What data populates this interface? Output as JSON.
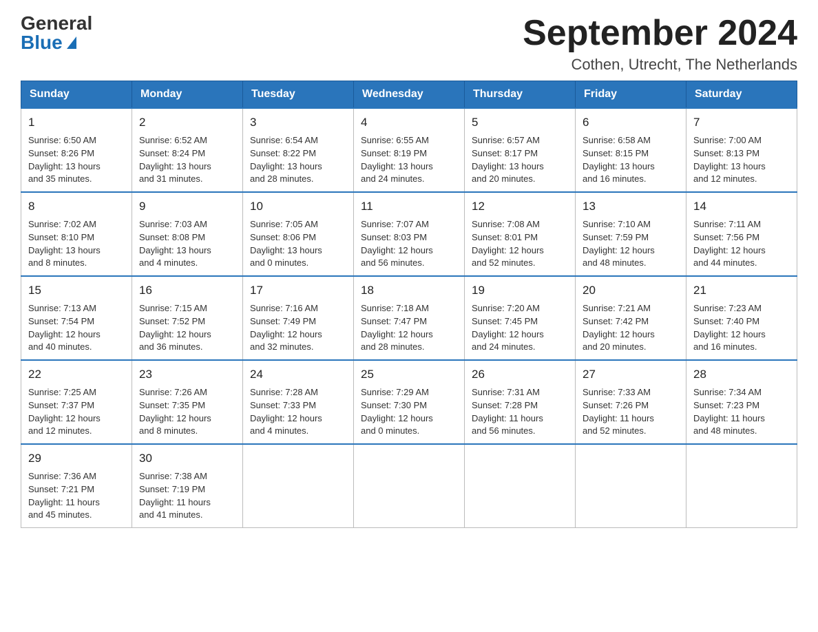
{
  "logo": {
    "general": "General",
    "blue": "Blue"
  },
  "title": {
    "month_year": "September 2024",
    "location": "Cothen, Utrecht, The Netherlands"
  },
  "weekdays": [
    "Sunday",
    "Monday",
    "Tuesday",
    "Wednesday",
    "Thursday",
    "Friday",
    "Saturday"
  ],
  "weeks": [
    [
      {
        "day": "1",
        "sunrise": "6:50 AM",
        "sunset": "8:26 PM",
        "daylight": "13 hours and 35 minutes."
      },
      {
        "day": "2",
        "sunrise": "6:52 AM",
        "sunset": "8:24 PM",
        "daylight": "13 hours and 31 minutes."
      },
      {
        "day": "3",
        "sunrise": "6:54 AM",
        "sunset": "8:22 PM",
        "daylight": "13 hours and 28 minutes."
      },
      {
        "day": "4",
        "sunrise": "6:55 AM",
        "sunset": "8:19 PM",
        "daylight": "13 hours and 24 minutes."
      },
      {
        "day": "5",
        "sunrise": "6:57 AM",
        "sunset": "8:17 PM",
        "daylight": "13 hours and 20 minutes."
      },
      {
        "day": "6",
        "sunrise": "6:58 AM",
        "sunset": "8:15 PM",
        "daylight": "13 hours and 16 minutes."
      },
      {
        "day": "7",
        "sunrise": "7:00 AM",
        "sunset": "8:13 PM",
        "daylight": "13 hours and 12 minutes."
      }
    ],
    [
      {
        "day": "8",
        "sunrise": "7:02 AM",
        "sunset": "8:10 PM",
        "daylight": "13 hours and 8 minutes."
      },
      {
        "day": "9",
        "sunrise": "7:03 AM",
        "sunset": "8:08 PM",
        "daylight": "13 hours and 4 minutes."
      },
      {
        "day": "10",
        "sunrise": "7:05 AM",
        "sunset": "8:06 PM",
        "daylight": "13 hours and 0 minutes."
      },
      {
        "day": "11",
        "sunrise": "7:07 AM",
        "sunset": "8:03 PM",
        "daylight": "12 hours and 56 minutes."
      },
      {
        "day": "12",
        "sunrise": "7:08 AM",
        "sunset": "8:01 PM",
        "daylight": "12 hours and 52 minutes."
      },
      {
        "day": "13",
        "sunrise": "7:10 AM",
        "sunset": "7:59 PM",
        "daylight": "12 hours and 48 minutes."
      },
      {
        "day": "14",
        "sunrise": "7:11 AM",
        "sunset": "7:56 PM",
        "daylight": "12 hours and 44 minutes."
      }
    ],
    [
      {
        "day": "15",
        "sunrise": "7:13 AM",
        "sunset": "7:54 PM",
        "daylight": "12 hours and 40 minutes."
      },
      {
        "day": "16",
        "sunrise": "7:15 AM",
        "sunset": "7:52 PM",
        "daylight": "12 hours and 36 minutes."
      },
      {
        "day": "17",
        "sunrise": "7:16 AM",
        "sunset": "7:49 PM",
        "daylight": "12 hours and 32 minutes."
      },
      {
        "day": "18",
        "sunrise": "7:18 AM",
        "sunset": "7:47 PM",
        "daylight": "12 hours and 28 minutes."
      },
      {
        "day": "19",
        "sunrise": "7:20 AM",
        "sunset": "7:45 PM",
        "daylight": "12 hours and 24 minutes."
      },
      {
        "day": "20",
        "sunrise": "7:21 AM",
        "sunset": "7:42 PM",
        "daylight": "12 hours and 20 minutes."
      },
      {
        "day": "21",
        "sunrise": "7:23 AM",
        "sunset": "7:40 PM",
        "daylight": "12 hours and 16 minutes."
      }
    ],
    [
      {
        "day": "22",
        "sunrise": "7:25 AM",
        "sunset": "7:37 PM",
        "daylight": "12 hours and 12 minutes."
      },
      {
        "day": "23",
        "sunrise": "7:26 AM",
        "sunset": "7:35 PM",
        "daylight": "12 hours and 8 minutes."
      },
      {
        "day": "24",
        "sunrise": "7:28 AM",
        "sunset": "7:33 PM",
        "daylight": "12 hours and 4 minutes."
      },
      {
        "day": "25",
        "sunrise": "7:29 AM",
        "sunset": "7:30 PM",
        "daylight": "12 hours and 0 minutes."
      },
      {
        "day": "26",
        "sunrise": "7:31 AM",
        "sunset": "7:28 PM",
        "daylight": "11 hours and 56 minutes."
      },
      {
        "day": "27",
        "sunrise": "7:33 AM",
        "sunset": "7:26 PM",
        "daylight": "11 hours and 52 minutes."
      },
      {
        "day": "28",
        "sunrise": "7:34 AM",
        "sunset": "7:23 PM",
        "daylight": "11 hours and 48 minutes."
      }
    ],
    [
      {
        "day": "29",
        "sunrise": "7:36 AM",
        "sunset": "7:21 PM",
        "daylight": "11 hours and 45 minutes."
      },
      {
        "day": "30",
        "sunrise": "7:38 AM",
        "sunset": "7:19 PM",
        "daylight": "11 hours and 41 minutes."
      },
      null,
      null,
      null,
      null,
      null
    ]
  ],
  "labels": {
    "sunrise": "Sunrise: ",
    "sunset": "Sunset: ",
    "daylight": "Daylight: "
  }
}
